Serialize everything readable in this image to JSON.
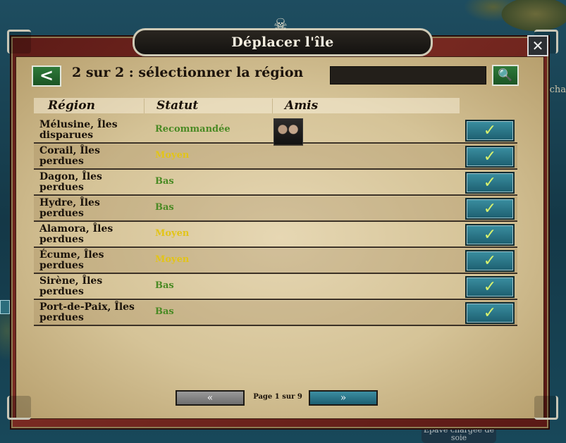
{
  "background": {
    "map_label": "Épave chargée de soie",
    "side_text": "cha"
  },
  "dialog": {
    "title": "Déplacer l'île",
    "close_icon": "✕",
    "step_title": "2 sur 2 : sélectionner la région",
    "back_icon": "<",
    "search": {
      "value": "",
      "placeholder": "",
      "icon": "search-icon"
    }
  },
  "table": {
    "headers": {
      "region": "Région",
      "status": "Statut",
      "friends": "Amis"
    },
    "rows": [
      {
        "region": "Mélusine, Îles disparues",
        "status": "Recommandée",
        "status_color": "green",
        "has_friend": true
      },
      {
        "region": "Corail, Îles perdues",
        "status": "Moyen",
        "status_color": "yellow"
      },
      {
        "region": "Dagon, Îles perdues",
        "status": "Bas",
        "status_color": "green"
      },
      {
        "region": "Hydre, Îles perdues",
        "status": "Bas",
        "status_color": "green"
      },
      {
        "region": "Alamora, Îles perdues",
        "status": "Moyen",
        "status_color": "yellow"
      },
      {
        "region": "Écume, Îles perdues",
        "status": "Moyen",
        "status_color": "yellow"
      },
      {
        "region": "Sirène, Îles perdues",
        "status": "Bas",
        "status_color": "green"
      },
      {
        "region": "Port-de-Paix, Îles perdues",
        "status": "Bas",
        "status_color": "green"
      }
    ],
    "select_icon": "✓"
  },
  "pager": {
    "prev_label": "«",
    "next_label": "»",
    "info": "Page 1 sur 9"
  },
  "colors": {
    "frame": "#6b211b",
    "parchment": "#dccaa0",
    "green_status": "#4a8a24",
    "yellow_status": "#e2c418",
    "select_button": "#2a7a8c"
  }
}
